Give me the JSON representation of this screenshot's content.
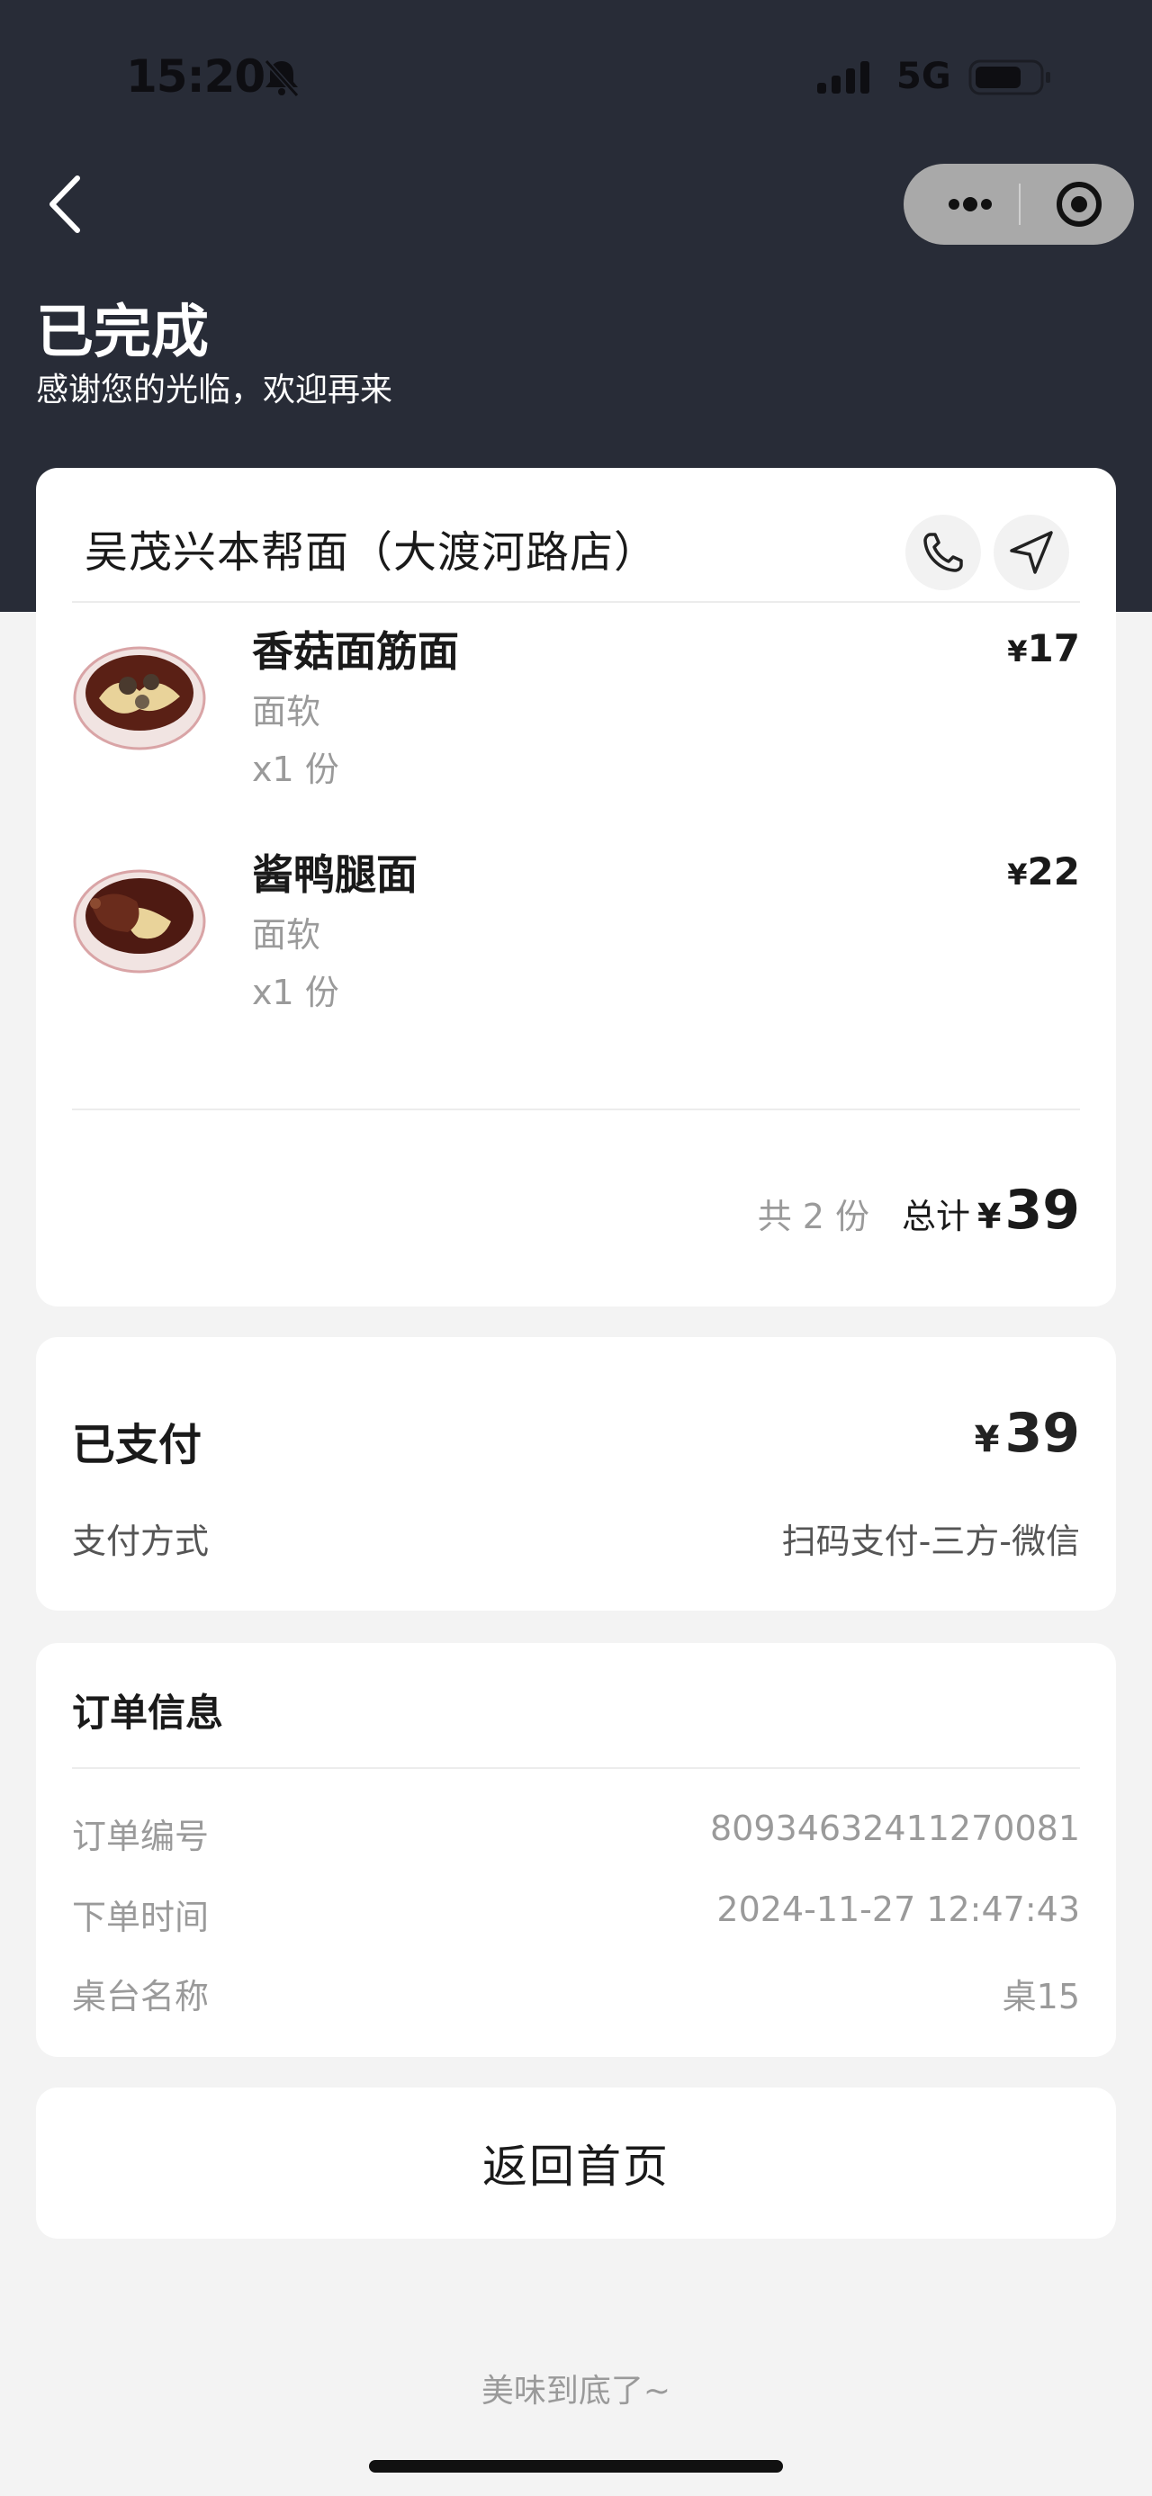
{
  "status_bar": {
    "time": "15:20",
    "network": "5G",
    "icons": [
      "bell-muted-icon",
      "signal-icon",
      "battery-icon"
    ]
  },
  "nav": {
    "back_icon": "chevron-left-icon",
    "capsule_icons": [
      "more-icon",
      "close-circle-icon"
    ]
  },
  "order_status": {
    "title": "已完成",
    "subtitle": "感谢您的光临，欢迎再来"
  },
  "store": {
    "name": "吴茂兴本帮面（大渡河路店）",
    "icons": [
      "phone-icon",
      "navigate-icon"
    ]
  },
  "items": [
    {
      "name": "香菇面筋面",
      "option": "面软",
      "quantity": "x1 份",
      "currency": "¥",
      "price": "17"
    },
    {
      "name": "酱鸭腿面",
      "option": "面软",
      "quantity": "x1 份",
      "currency": "¥",
      "price": "22"
    }
  ],
  "summary": {
    "count_text": "共 2 份",
    "total_label": "总计",
    "currency": "¥",
    "total": "39"
  },
  "payment": {
    "label": "已支付",
    "currency": "¥",
    "amount": "39",
    "method_label": "支付方式",
    "method_value": "扫码支付-三方-微信"
  },
  "order_info": {
    "title": "订单信息",
    "rows": [
      {
        "label": "订单编号",
        "value": "80934632411270081"
      },
      {
        "label": "下单时间",
        "value": "2024-11-27 12:47:43"
      },
      {
        "label": "桌台名称",
        "value": "桌15"
      }
    ]
  },
  "home_button": "返回首页",
  "footer": "美味到底了~",
  "colors": {
    "header_bg": "#282c37",
    "page_bg": "#f3f3f3",
    "card_bg": "#ffffff",
    "capsule_bg": "#a9a9a9"
  }
}
